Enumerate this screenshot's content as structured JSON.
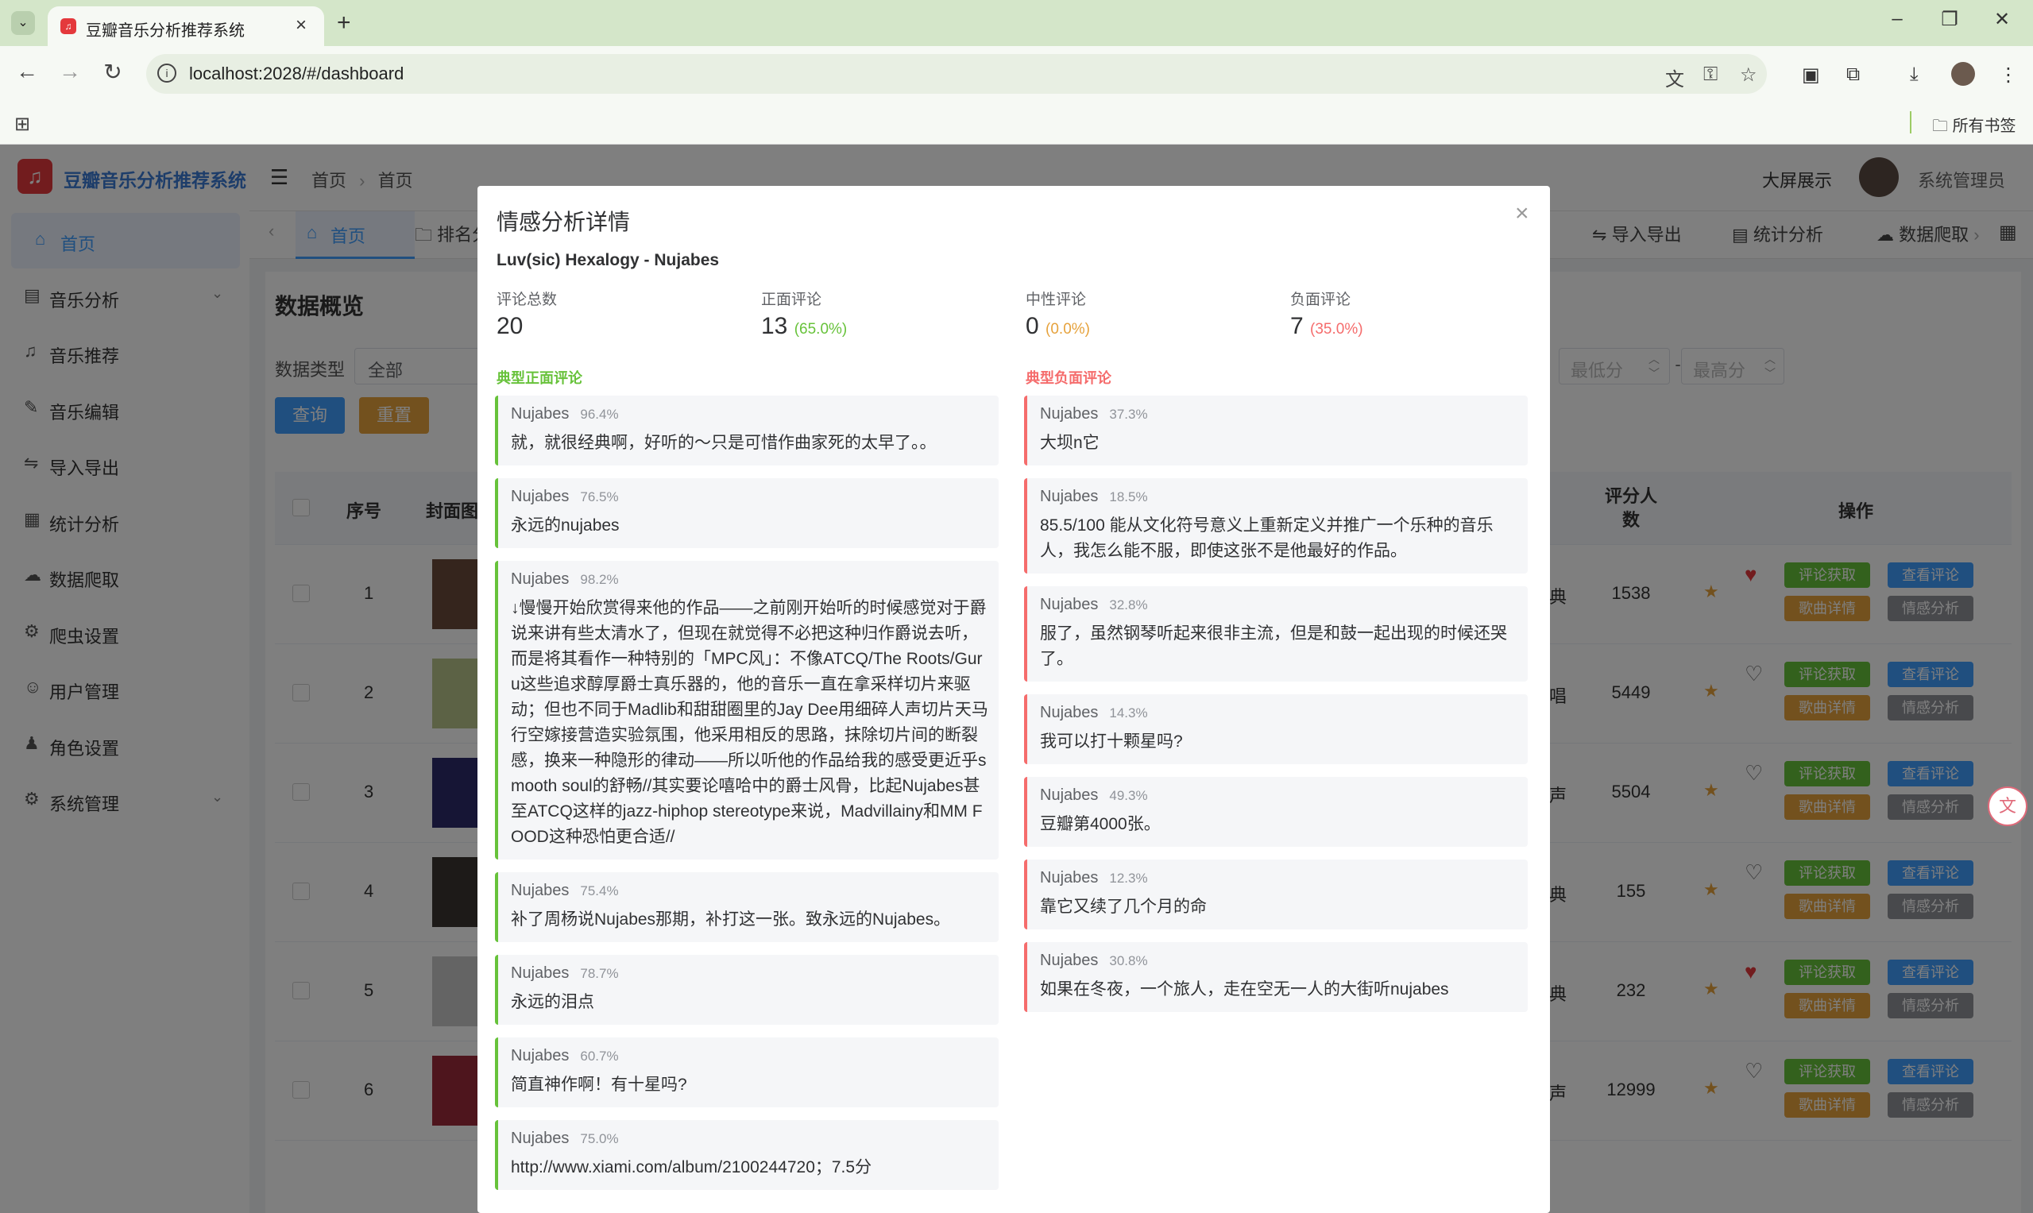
{
  "browser": {
    "tab_title": "豆瓣音乐分析推荐系统",
    "url": "localhost:2028/#/dashboard",
    "bookmarks_label": "所有书签"
  },
  "app": {
    "logo_text": "豆瓣音乐分析推荐系统",
    "sidebar": [
      {
        "icon": "home-icon",
        "glyph": "⌂",
        "label": "首页",
        "active": true
      },
      {
        "icon": "chart-icon",
        "glyph": "▤",
        "label": "音乐分析",
        "arrow": true
      },
      {
        "icon": "headphones-icon",
        "glyph": "♫",
        "label": "音乐推荐"
      },
      {
        "icon": "edit-icon",
        "glyph": "✎",
        "label": "音乐编辑"
      },
      {
        "icon": "import-export-icon",
        "glyph": "⇋",
        "label": "导入导出"
      },
      {
        "icon": "stats-icon",
        "glyph": "▦",
        "label": "统计分析"
      },
      {
        "icon": "spider-icon",
        "glyph": "☁",
        "label": "数据爬取"
      },
      {
        "icon": "settings-icon",
        "glyph": "⚙",
        "label": "爬虫设置"
      },
      {
        "icon": "user-icon",
        "glyph": "☺",
        "label": "用户管理"
      },
      {
        "icon": "role-icon",
        "glyph": "♟",
        "label": "角色设置"
      },
      {
        "icon": "system-icon",
        "glyph": "⚙",
        "label": "系统管理",
        "arrow": true
      }
    ],
    "header": {
      "breadcrumb_1": "首页",
      "breadcrumb_2": "首页",
      "big_screen": "大屏展示",
      "user": "系统管理员"
    },
    "tags": {
      "home": "首页",
      "rank": "排名分",
      "import": "导入导出",
      "stats": "统计分析",
      "crawl": "数据爬取"
    },
    "content": {
      "title": "数据概览",
      "data_type_label": "数据类型",
      "data_type_value": "全部",
      "min_score_placeholder": "最低分",
      "max_score_placeholder": "最高分",
      "query_btn": "查询",
      "reset_btn": "重置",
      "col_index": "序号",
      "col_cover": "封面图",
      "col_raters": "评分人数",
      "col_actions": "操作",
      "btn_fetch": "评论获取",
      "btn_view": "查看评论",
      "btn_detail": "歌曲详情",
      "btn_sentiment": "情感分析",
      "rows": [
        {
          "index": "1",
          "side": "典",
          "raters": "1538",
          "liked": true
        },
        {
          "index": "2",
          "side": "唱",
          "raters": "5449",
          "liked": false
        },
        {
          "index": "3",
          "side": "声",
          "raters": "5504",
          "liked": false
        },
        {
          "index": "4",
          "side": "典",
          "raters": "155",
          "liked": false
        },
        {
          "index": "5",
          "side": "典",
          "raters": "232",
          "liked": true
        },
        {
          "index": "6",
          "side": "声",
          "raters": "12999",
          "liked": false
        }
      ]
    }
  },
  "modal": {
    "title": "情感分析详情",
    "song": "Luv(sic) Hexalogy - Nujabes",
    "stats": [
      {
        "label": "评论总数",
        "value": "20",
        "pct": ""
      },
      {
        "label": "正面评论",
        "value": "13",
        "pct": "(65.0%)",
        "color": "#67c23a"
      },
      {
        "label": "中性评论",
        "value": "0",
        "pct": "(0.0%)",
        "color": "#e6a23c"
      },
      {
        "label": "负面评论",
        "value": "7",
        "pct": "(35.0%)",
        "color": "#f56c6c"
      }
    ],
    "positive_title": "典型正面评论",
    "negative_title": "典型负面评论",
    "positive": [
      {
        "author": "Nujabes",
        "score": "96.4%",
        "text": "就，就很经典啊，好听的～只是可惜作曲家死的太早了。。"
      },
      {
        "author": "Nujabes",
        "score": "76.5%",
        "text": "永远的nujabes"
      },
      {
        "author": "Nujabes",
        "score": "98.2%",
        "text": "↓慢慢开始欣赏得来他的作品——之前刚开始听的时候感觉对于爵说来讲有些太清水了，但现在就觉得不必把这种归作爵说去听，而是将其看作一种特别的「MPC风」：不像ATCQ/The Roots/Guru这些追求醇厚爵士真乐器的，他的音乐一直在拿采样切片来驱动；但也不同于Madlib和甜甜圈里的Jay Dee用细碎人声切片天马行空嫁接营造实验氛围，他采用相反的思路，抹除切片间的断裂感，换来一种隐形的律动——所以听他的作品给我的感受更近乎smooth soul的舒畅//其实要论嘻哈中的爵士风骨，比起Nujabes甚至ATCQ这样的jazz-hiphop stereotype来说，Madvillainy和MM FOOD这种恐怕更合适//"
      },
      {
        "author": "Nujabes",
        "score": "75.4%",
        "text": "补了周杨说Nujabes那期，补打这一张。致永远的Nujabes。"
      },
      {
        "author": "Nujabes",
        "score": "78.7%",
        "text": "永远的泪点"
      },
      {
        "author": "Nujabes",
        "score": "60.7%",
        "text": "简直神作啊！有十星吗?"
      },
      {
        "author": "Nujabes",
        "score": "75.0%",
        "text": "http://www.xiami.com/album/2100244720；7.5分"
      }
    ],
    "negative": [
      {
        "author": "Nujabes",
        "score": "37.3%",
        "text": "大坝n它"
      },
      {
        "author": "Nujabes",
        "score": "18.5%",
        "text": "85.5/100 能从文化符号意义上重新定义并推广一个乐种的音乐人，我怎么能不服，即使这张不是他最好的作品。"
      },
      {
        "author": "Nujabes",
        "score": "32.8%",
        "text": "服了，虽然钢琴听起来很非主流，但是和鼓一起出现的时候还哭了。"
      },
      {
        "author": "Nujabes",
        "score": "14.3%",
        "text": "我可以打十颗星吗?"
      },
      {
        "author": "Nujabes",
        "score": "49.3%",
        "text": "豆瓣第4000张。"
      },
      {
        "author": "Nujabes",
        "score": "12.3%",
        "text": "靠它又续了几个月的命"
      },
      {
        "author": "Nujabes",
        "score": "30.8%",
        "text": "如果在冬夜，一个旅人，走在空无一人的大街听nujabes"
      }
    ]
  }
}
